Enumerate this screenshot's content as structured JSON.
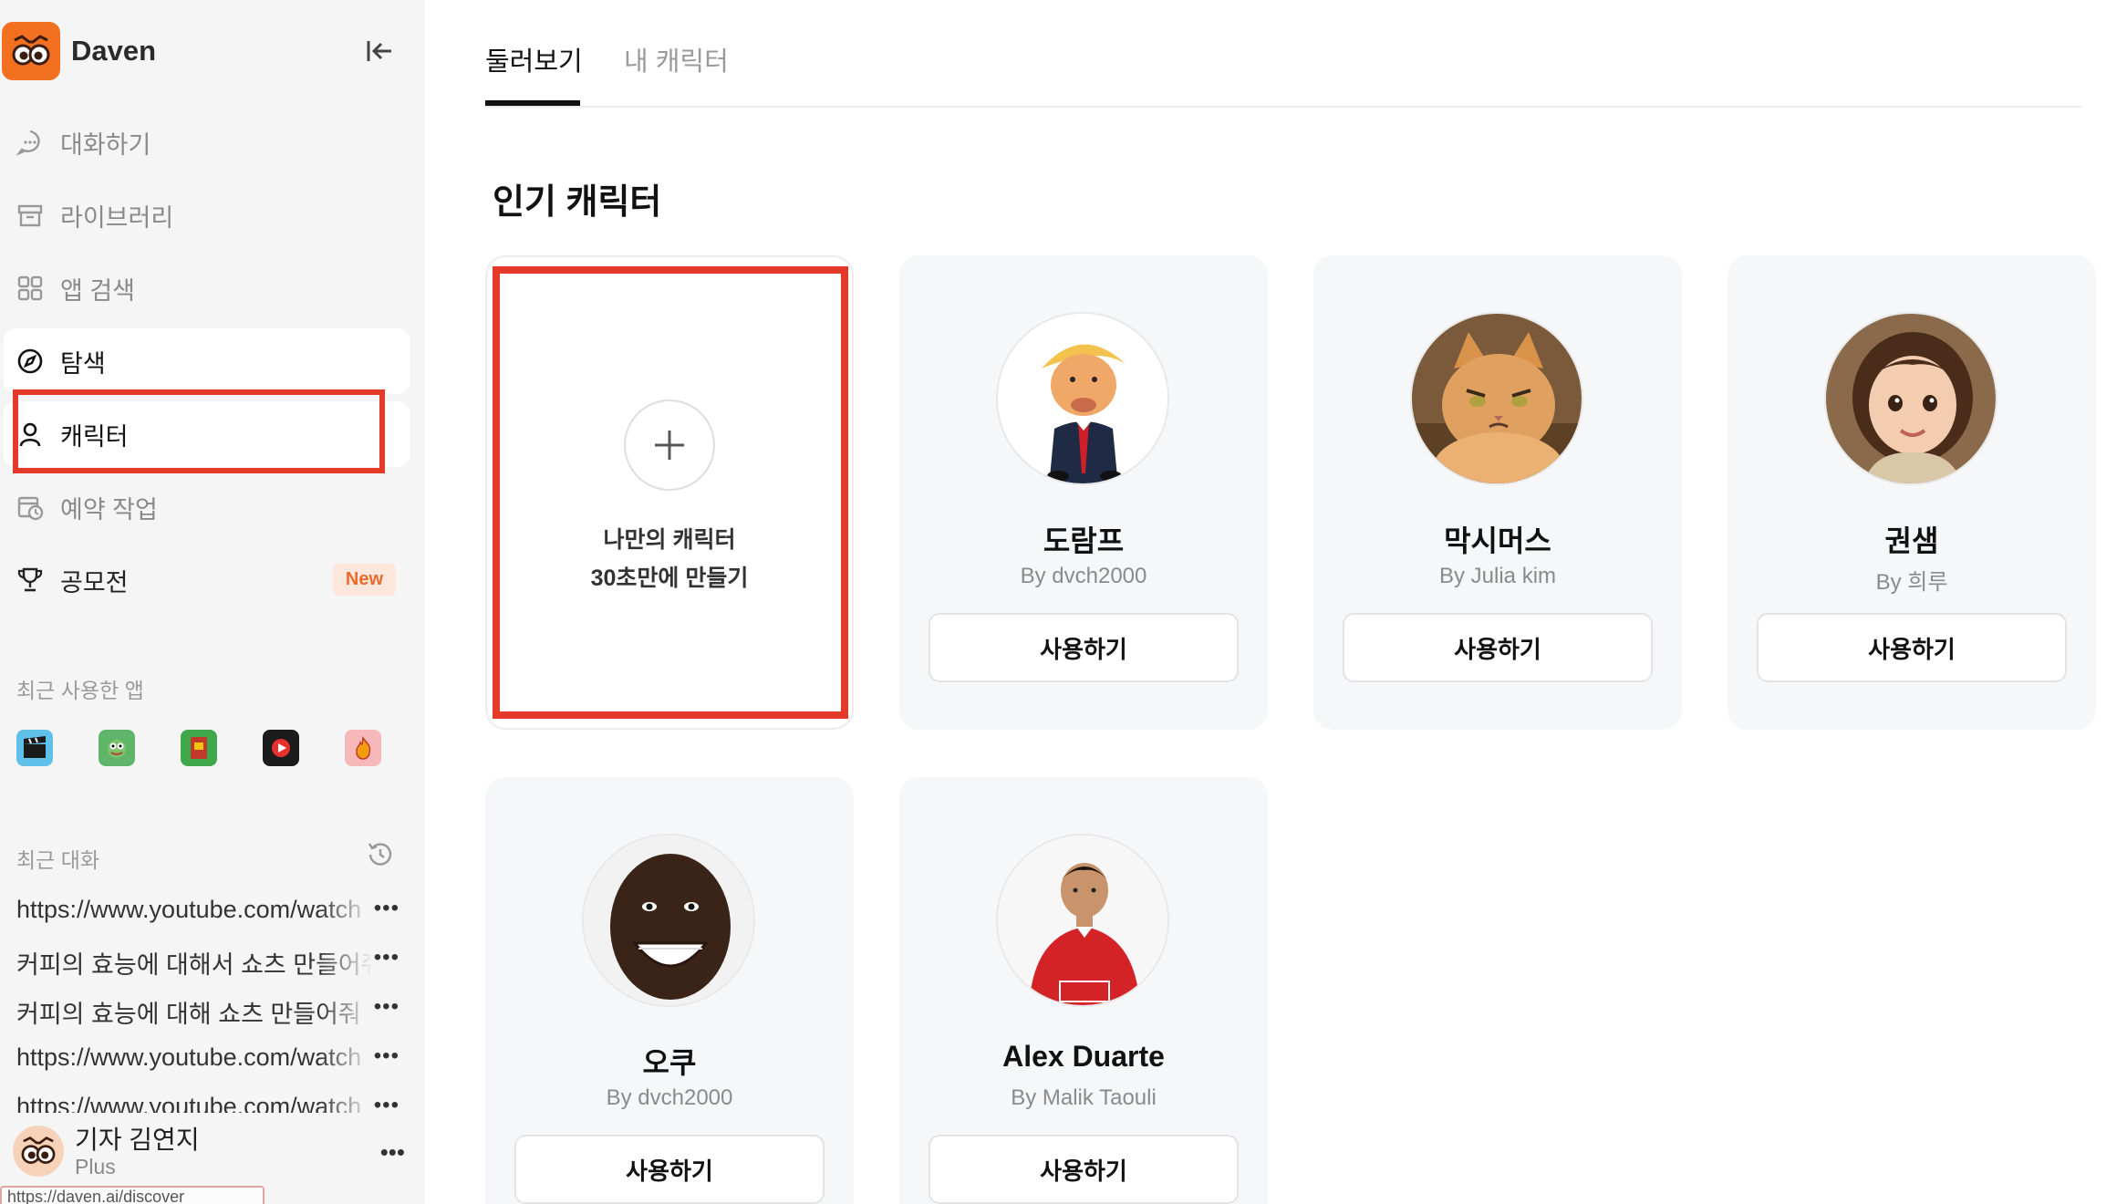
{
  "brand": {
    "name": "Daven",
    "logo_icon": "owl-face-icon",
    "accent": "#f37021"
  },
  "nav": [
    {
      "label": "대화하기",
      "icon": "chat-bubble-icon"
    },
    {
      "label": "라이브러리",
      "icon": "archive-box-icon"
    },
    {
      "label": "앱 검색",
      "icon": "grid-icon"
    },
    {
      "label": "탐색",
      "icon": "compass-icon"
    },
    {
      "label": "캐릭터",
      "icon": "person-icon"
    },
    {
      "label": "예약 작업",
      "icon": "calendar-clock-icon"
    },
    {
      "label": "공모전",
      "icon": "trophy-icon",
      "badge": "New"
    }
  ],
  "recent_apps": {
    "label": "최근 사용한 앱"
  },
  "recent_chats": {
    "label": "최근 대화",
    "items": [
      "https://www.youtube.com/watch",
      "커피의 효능에 대해서 쇼츠 만들어줘",
      "커피의 효능에 대해 쇼츠 만들어줘",
      "https://www.youtube.com/watch",
      "https://www.youtube.com/watch"
    ],
    "more": "•••"
  },
  "user": {
    "name": "기자 김연지",
    "plan": "Plus",
    "more": "•••"
  },
  "status_url": "https://daven.ai/discover",
  "tabs": [
    {
      "label": "둘러보기"
    },
    {
      "label": "내 캐릭터"
    }
  ],
  "section_title": "인기 캐릭터",
  "create_card": {
    "line1": "나만의 캐릭터",
    "line2": "30초만에 만들기"
  },
  "characters": [
    {
      "name": "도람프",
      "author": "By dvch2000",
      "button": "사용하기"
    },
    {
      "name": "막시머스",
      "author": "By Julia kim",
      "button": "사용하기"
    },
    {
      "name": "권샘",
      "author": "By 희루",
      "button": "사용하기"
    },
    {
      "name": "오쿠",
      "author": "By dvch2000",
      "button": "사용하기"
    },
    {
      "name": "Alex Duarte",
      "author": "By Malik Taouli",
      "button": "사용하기"
    }
  ],
  "colors": {
    "highlight": "#e53a2a",
    "badge_text": "#ea6a2b",
    "badge_bg": "#fde7dc"
  }
}
